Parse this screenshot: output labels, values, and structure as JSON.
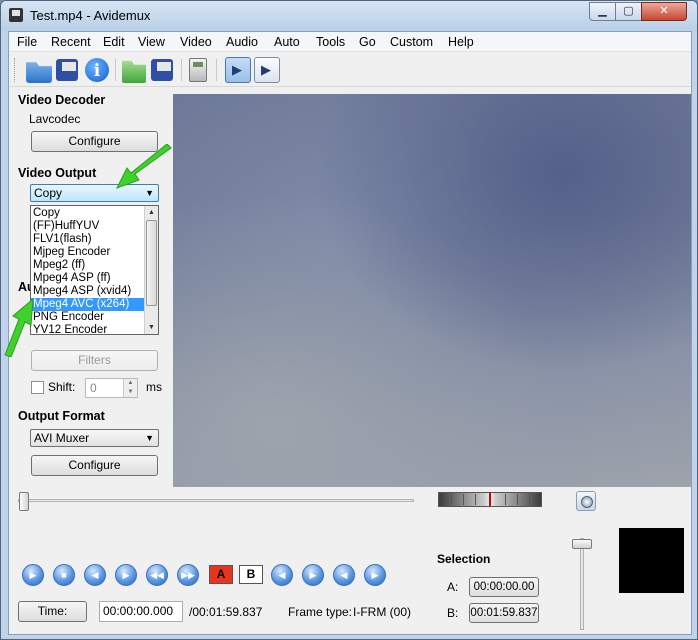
{
  "window": {
    "title": "Test.mp4 - Avidemux"
  },
  "menu": [
    "File",
    "Recent",
    "Edit",
    "View",
    "Video",
    "Audio",
    "Auto",
    "Tools",
    "Go",
    "Custom",
    "Help"
  ],
  "toolbar": {
    "icons": [
      "open-icon",
      "save-icon",
      "info-icon",
      "open-folder-icon",
      "save-as-icon",
      "calculator-icon",
      "input-mode-icon",
      "output-mode-icon"
    ]
  },
  "video_decoder": {
    "title": "Video Decoder",
    "codec": "Lavcodec",
    "configure_label": "Configure"
  },
  "video_output": {
    "title": "Video Output",
    "selected": "Copy",
    "options": [
      "Copy",
      "(FF)HuffYUV",
      "FLV1(flash)",
      "Mjpeg Encoder",
      "Mpeg2 (ff)",
      "Mpeg4 ASP (ff)",
      "Mpeg4 ASP (xvid4)",
      "Mpeg4 AVC (x264)",
      "PNG Encoder",
      "YV12 Encoder"
    ],
    "highlighted": "Mpeg4 AVC (x264)"
  },
  "audio_output": {
    "title_partial": "Au",
    "filters_label": "Filters",
    "shift_label": "Shift:",
    "shift_value": "0",
    "shift_unit": "ms"
  },
  "output_format": {
    "title": "Output Format",
    "selected": "AVI Muxer",
    "configure_label": "Configure"
  },
  "playback": {
    "buttons": [
      "play-icon",
      "stop-icon",
      "previous-frame-icon",
      "next-frame-icon",
      "previous-keyframe-icon",
      "next-keyframe-icon"
    ],
    "marker_a_label": "A",
    "marker_b_label": "B",
    "more_buttons": [
      "go-to-marker-a-icon",
      "go-to-marker-b-icon",
      "previous-black-frame-icon",
      "next-black-frame-icon"
    ]
  },
  "selection": {
    "title": "Selection",
    "a_label": "A:",
    "a_value": "00:00:00.00",
    "b_label": "B:",
    "b_value": "00:01:59.837"
  },
  "status": {
    "time_button": "Time:",
    "current_time": "00:00:00.000",
    "total_time": "/00:01:59.837",
    "frame_type_label": "Frame type:",
    "frame_type_value": "I-FRM (00)"
  },
  "colors": {
    "selection_blue": "#3399ff",
    "annotation_green": "#3fd12c",
    "marker_red": "#e8351e"
  }
}
